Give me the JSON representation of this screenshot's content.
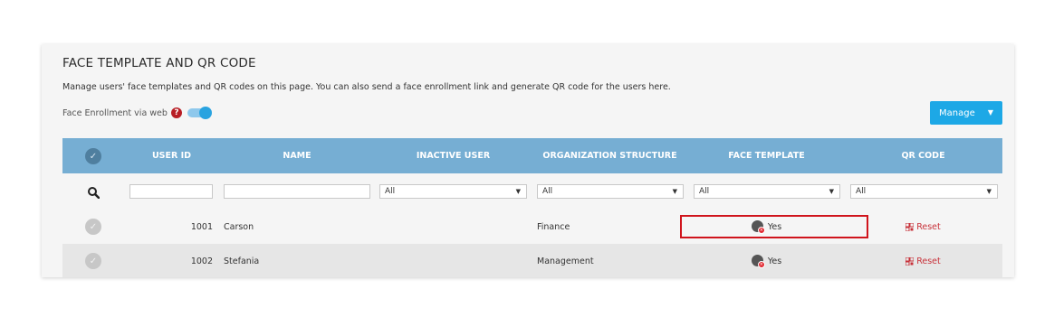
{
  "panel": {
    "title": "FACE TEMPLATE AND QR CODE",
    "description": "Manage users' face templates and QR codes on this page. You can also send a face enrollment link and generate QR code for the users here.",
    "enrollment_label": "Face Enrollment via web",
    "enrollment_enabled": true
  },
  "toolbar": {
    "manage_label": "Manage"
  },
  "table": {
    "columns": {
      "user_id": "USER ID",
      "name": "NAME",
      "inactive_user": "INACTIVE USER",
      "org_structure": "ORGANIZATION STRUCTURE",
      "face_template": "FACE TEMPLATE",
      "qr_code": "QR CODE"
    },
    "filters": {
      "user_id": "",
      "name": "",
      "inactive_user": "All",
      "org_structure": "All",
      "face_template": "All",
      "qr_code": "All"
    },
    "rows": [
      {
        "user_id": "1001",
        "name": "Carson",
        "org": "Finance",
        "face_template": "Yes",
        "qr_action": "Reset"
      },
      {
        "user_id": "1002",
        "name": "Stefania",
        "org": "Management",
        "face_template": "Yes",
        "qr_action": "Reset"
      }
    ]
  },
  "colors": {
    "header_bg": "#76aed3",
    "accent": "#1da8e6",
    "highlight": "#d0141c",
    "reset_text": "#c8323a"
  },
  "icons": [
    "help-icon",
    "toggle-switch",
    "chevron-down-icon",
    "check-icon",
    "search-icon",
    "face-icon",
    "qr-code-icon"
  ]
}
